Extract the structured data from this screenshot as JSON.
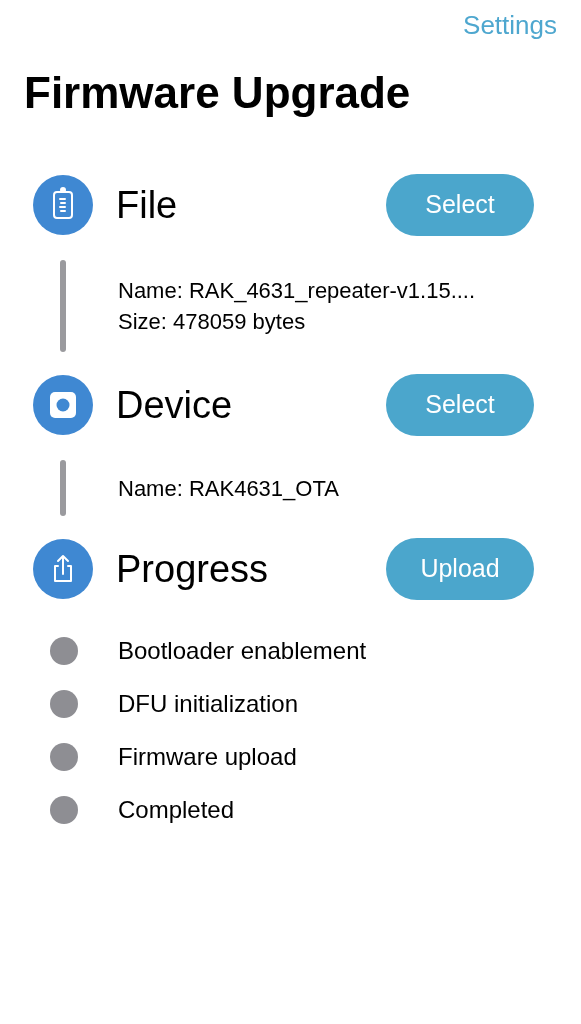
{
  "top_link": "Settings",
  "title": "Firmware Upgrade",
  "sections": [
    {
      "kind": "file",
      "title": "File",
      "button": "Select",
      "details": [
        "Name: RAK_4631_repeater-v1.15....",
        "Size: 478059 bytes"
      ]
    },
    {
      "kind": "device",
      "title": "Device",
      "button": "Select",
      "details": [
        "Name: RAK4631_OTA"
      ]
    },
    {
      "kind": "progress",
      "title": "Progress",
      "button": "Upload",
      "steps": [
        {
          "label": "Bootloader enablement",
          "done": false
        },
        {
          "label": "DFU initialization",
          "done": false
        },
        {
          "label": "Firmware upload",
          "done": false
        },
        {
          "label": "Completed",
          "done": false
        }
      ]
    }
  ]
}
